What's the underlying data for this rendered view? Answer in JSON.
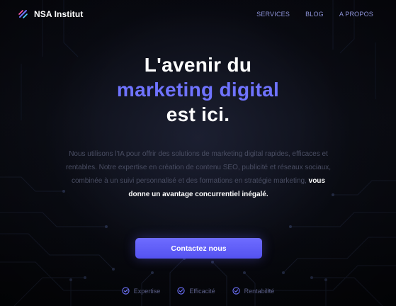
{
  "header": {
    "brand_name": "NSA Institut",
    "nav": [
      {
        "label": "SERVICES"
      },
      {
        "label": "BLOG"
      },
      {
        "label": "A PROPOS"
      }
    ]
  },
  "hero": {
    "title_line1": "L'avenir du",
    "title_line2": "marketing digital",
    "title_line3": "est ici.",
    "description": "Nous utilisons l'IA pour offrir des solutions de marketing digital rapides, efficaces et rentables. Notre expertise en création de contenu SEO, publicité et réseaux sociaux, combinée à un suivi personnalisé et des formations en stratégie marketing,",
    "description_highlight": "vous donne un avantage concurrentiel inégalé.",
    "cta_label": "Contactez nous",
    "features": [
      {
        "label": "Expertise",
        "icon": "check-circle-icon"
      },
      {
        "label": "Efficacité",
        "icon": "check-circle-icon"
      },
      {
        "label": "Rentabilité",
        "icon": "check-circle-icon"
      }
    ]
  },
  "colors": {
    "accent": "#6f73ff",
    "button": "#5f5dfa",
    "background": "#0a0c14",
    "nav_text": "#8d93d8"
  }
}
